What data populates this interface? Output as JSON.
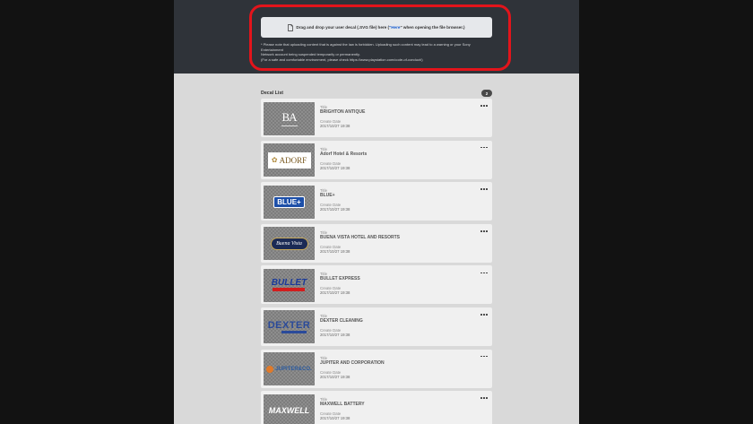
{
  "upload": {
    "drop_text_before": "Drag and drop your user decal (.SVG file) here (",
    "drop_link": "Here",
    "drop_text_after": "\" when opening the file browser.)",
    "notice_line1": "* Please note that uploading content that is against the law is forbidden. Uploading such content may lead to a warning or your Sony Entertainment",
    "notice_line2": "Network account being suspended temporarily or permanently.",
    "notice_line3": "(For a safe and comfortable environment, please check https://www.playstation.com/code-of-conduct/)"
  },
  "decal_list": {
    "title": "Decal List",
    "count": "2",
    "title_label": "Title",
    "date_label": "Create Date",
    "items": [
      {
        "title": "BRIGHTON ANTIQUE",
        "date": "2017/10/27 19:38",
        "logo": "BA"
      },
      {
        "title": "Adorf Hotel & Resorts",
        "date": "2017/10/27 19:38",
        "logo": "ADORF"
      },
      {
        "title": "BLUE+",
        "date": "2017/10/27 19:38",
        "logo": "BLUE+"
      },
      {
        "title": "BUENA VISTA HOTEL AND RESORTS",
        "date": "2017/10/27 19:38",
        "logo": "Buena Vista"
      },
      {
        "title": "BULLET EXPRESS",
        "date": "2017/10/27 19:38",
        "logo": "BULLET"
      },
      {
        "title": "DEXTER CLEANING",
        "date": "2017/10/27 19:38",
        "logo": "DEXTER"
      },
      {
        "title": "JUPITER AND CORPORATION",
        "date": "2017/10/27 19:38",
        "logo": "JUPITER&CO."
      },
      {
        "title": "MAXWELL BATTERY",
        "date": "2017/10/27 19:38",
        "logo": "MAXWELL"
      }
    ]
  },
  "colors": {
    "highlight_ring": "#e3141b",
    "link": "#1a5fd1",
    "band": "#2f3339"
  }
}
